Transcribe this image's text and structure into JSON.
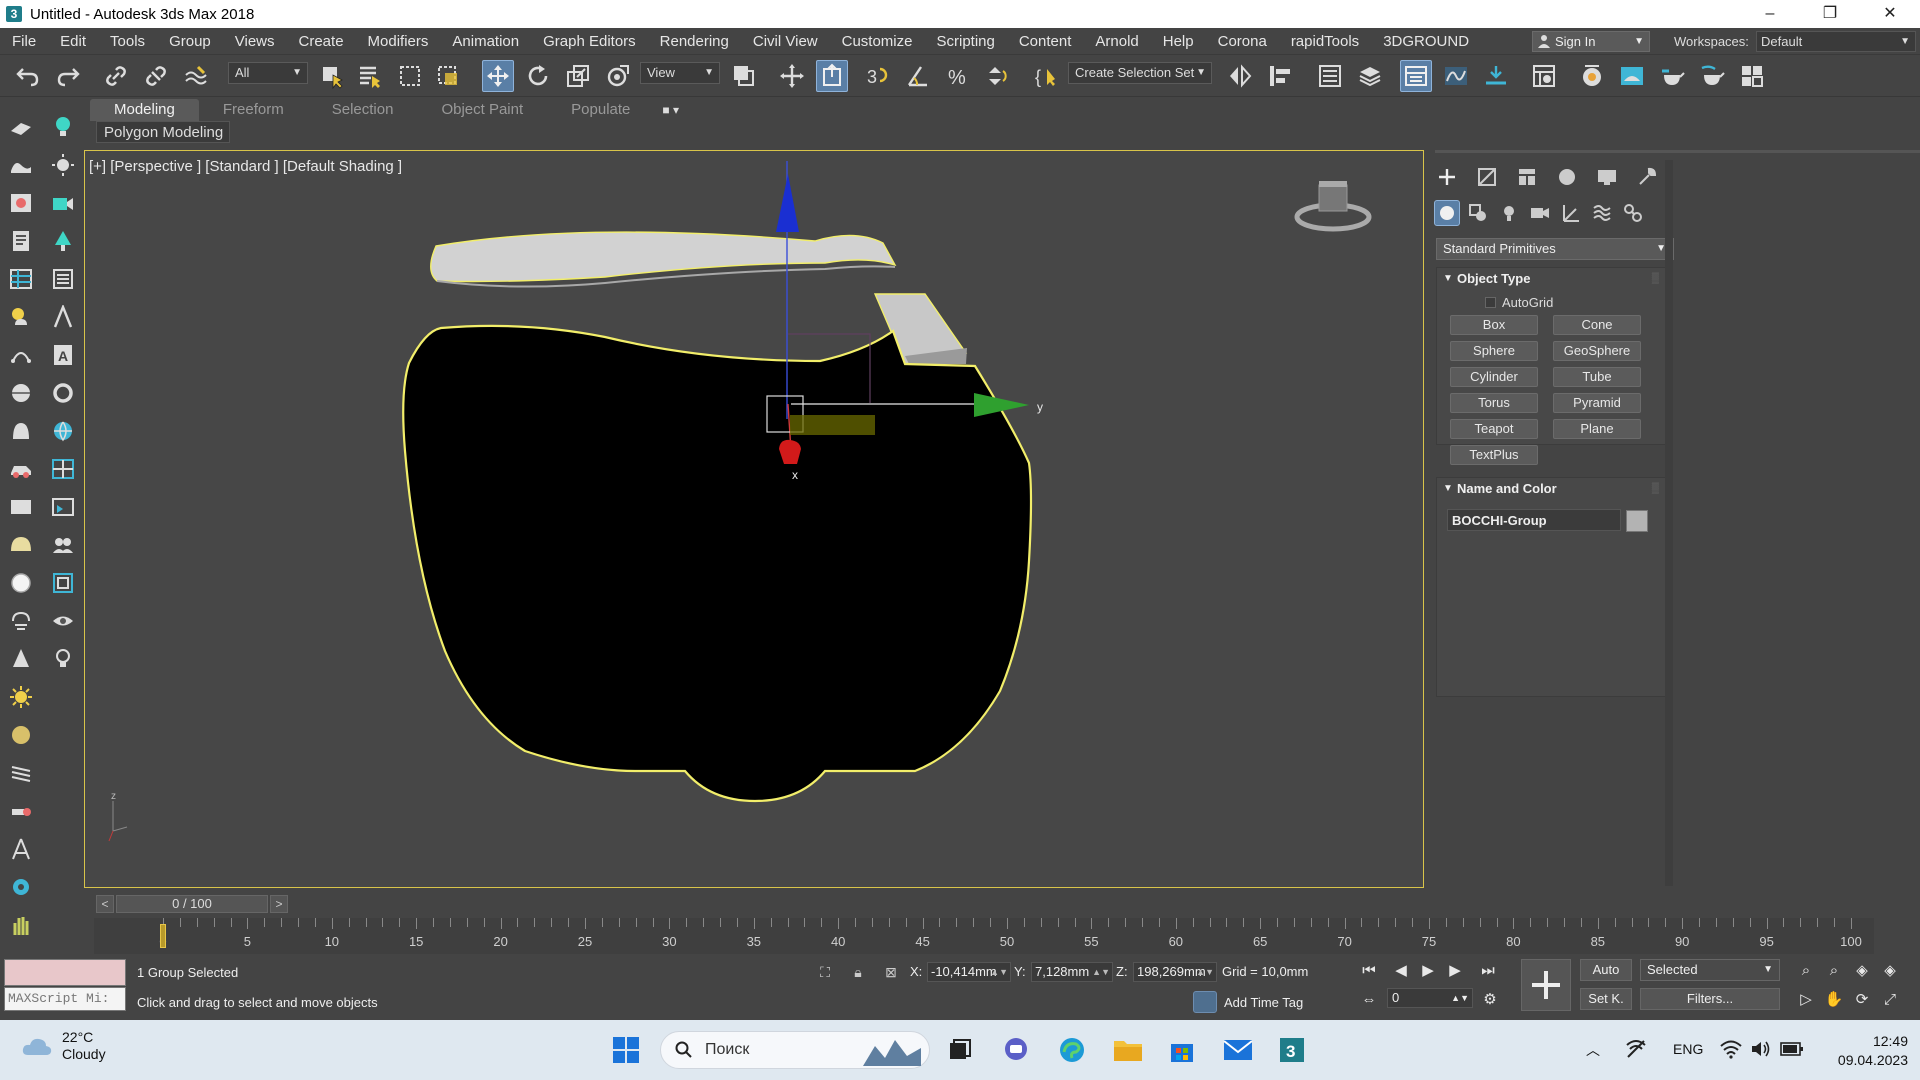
{
  "window": {
    "title": "Untitled - Autodesk 3ds Max 2018",
    "app_icon": "3",
    "controls": [
      "–",
      "❐",
      "✕"
    ]
  },
  "menu": [
    "File",
    "Edit",
    "Tools",
    "Group",
    "Views",
    "Create",
    "Modifiers",
    "Animation",
    "Graph Editors",
    "Rendering",
    "Civil View",
    "Customize",
    "Scripting",
    "Content",
    "Arnold",
    "Help",
    "Corona",
    "rapidTools",
    "3DGROUND"
  ],
  "account": {
    "signin_label": "Sign In",
    "workspaces_label": "Workspaces:",
    "workspace_value": "Default"
  },
  "toolbar": {
    "selection_filter": "All",
    "reference_coord": "View",
    "named_selection": "Create Selection Set"
  },
  "ribbon": {
    "tabs": [
      "Modeling",
      "Freeform",
      "Selection",
      "Object Paint",
      "Populate"
    ],
    "active_tab": "Modeling",
    "sub_label": "Polygon Modeling"
  },
  "viewport": {
    "label": "[+] [Perspective ] [Standard ] [Default Shading ]",
    "gizmo": {
      "x_label": "x",
      "y_label": "y",
      "z_label": "z"
    },
    "axis_tripod": {
      "x": "x",
      "z": "z"
    }
  },
  "command_panel": {
    "category_dropdown": "Standard Primitives",
    "object_type": {
      "title": "Object Type",
      "autogrid": "AutoGrid",
      "buttons": [
        "Box",
        "Cone",
        "Sphere",
        "GeoSphere",
        "Cylinder",
        "Tube",
        "Torus",
        "Pyramid",
        "Teapot",
        "Plane",
        "TextPlus"
      ]
    },
    "name_and_color": {
      "title": "Name and Color",
      "name": "BOCCHI-Group",
      "color": "#b3b3b3"
    }
  },
  "timeline": {
    "current": "0 / 100",
    "prev": "<",
    "next": ">",
    "ticks": [
      "0",
      "5",
      "10",
      "15",
      "20",
      "25",
      "30",
      "35",
      "40",
      "45",
      "50",
      "55",
      "60",
      "65",
      "70",
      "75",
      "80",
      "85",
      "90",
      "95",
      "100"
    ],
    "frame": 0
  },
  "status": {
    "maxscript_mini": "MAXScript Mi:",
    "selection": "1 Group Selected",
    "prompt": "Click and drag to select and move objects",
    "x_label": "X:",
    "x": "-10,414mm",
    "y_label": "Y:",
    "y": "7,128mm",
    "z_label": "Z:",
    "z": "198,269mm",
    "grid": "Grid = 10,0mm",
    "add_time_tag": "Add Time Tag",
    "frame_value": "0",
    "auto_key": "Auto",
    "set_key": "Set K.",
    "key_filter_sel": "Selected",
    "filters": "Filters..."
  },
  "taskbar": {
    "weather_temp": "22°C",
    "weather_desc": "Cloudy",
    "search_placeholder": "Поиск",
    "lang": "ENG",
    "time": "12:49",
    "date": "09.04.2023"
  },
  "colors": {
    "selection_outline": "#f2ee6a",
    "viewport_bg": "#474747",
    "active_blue": "#5a7fa6"
  }
}
